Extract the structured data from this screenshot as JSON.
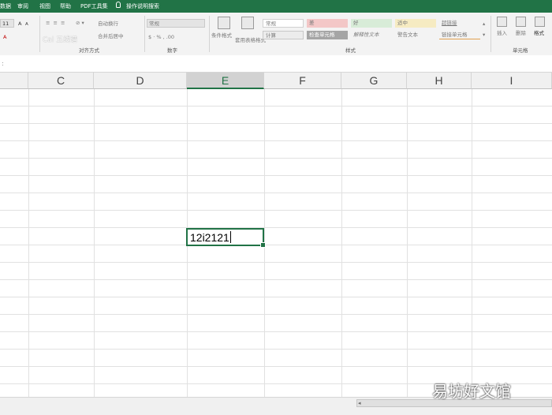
{
  "menu": {
    "tabs": [
      "数据",
      "审阅",
      "视图",
      "帮助",
      "PDF工具集",
      "操作说明搜索"
    ]
  },
  "ribbon": {
    "font_size": "11",
    "font_grow": "A",
    "font_shrink": "A",
    "font_color_label": "A",
    "wrap_text": "自动换行",
    "merge_center": "合并后居中",
    "number_format": "常规",
    "conditional_format": "条件格式",
    "table_format": "套用表格格式",
    "style_cells": [
      "常规",
      "差",
      "好",
      "适中",
      "超链接",
      "计算",
      "检查单元格",
      "解释性文本",
      "警告文本",
      "链接单元格"
    ],
    "insert": "插入",
    "delete": "删除",
    "format": "格式",
    "group_labels": {
      "alignment": "对齐方式",
      "number": "数字",
      "styles": "样式",
      "cells": "单元格"
    },
    "overlay_text": "Cal 五线谱"
  },
  "columns": [
    "C",
    "D",
    "E",
    "F",
    "G",
    "H",
    "I"
  ],
  "selected_column": "E",
  "active_cell": {
    "column": "E",
    "value": "12i2121"
  },
  "watermark": "易坊好文馆",
  "colors": {
    "accent": "#217346",
    "ribbon_bg": "#f3f3f3",
    "gridline": "#e1e1e1"
  }
}
